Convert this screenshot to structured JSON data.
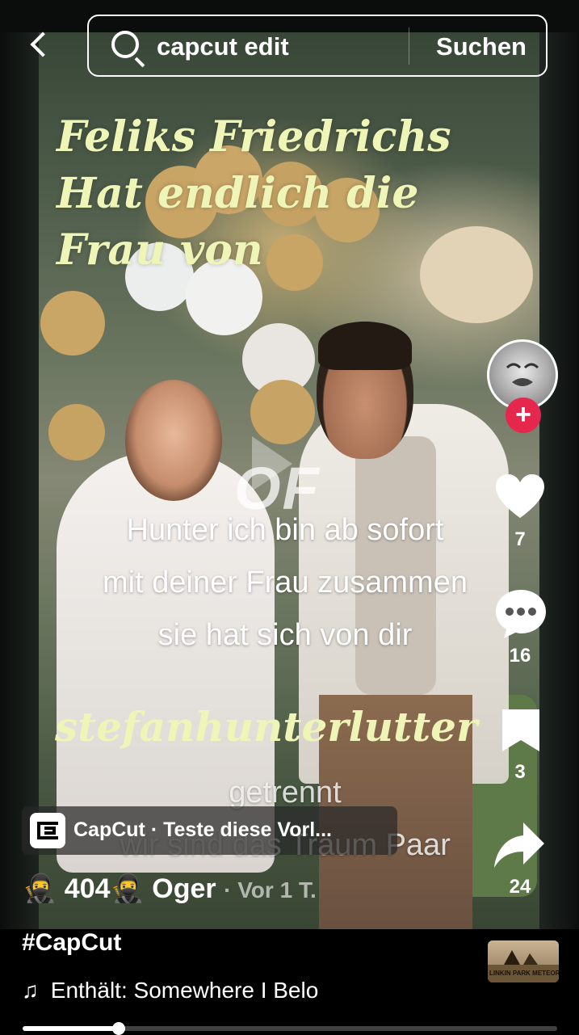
{
  "search": {
    "query": "capcut edit",
    "button_label": "Suchen"
  },
  "video": {
    "title_lines": [
      "Feliks Friedrichs",
      "Hat endlich die",
      "Frau von"
    ],
    "watermark": "OF",
    "caption_lines": [
      "Hunter ich bin ab sofort",
      "mit deiner Frau zusammen",
      "sie hat sich von dir"
    ],
    "handle_overlay": "stefanhunterlutter",
    "caption_lines_2": [
      "getrennt",
      "wir sind das Traum Paar"
    ]
  },
  "actions": {
    "likes": "7",
    "comments": "16",
    "saves": "3",
    "shares": "24"
  },
  "capcut": {
    "label": "CapCut · Teste diese Vorl..."
  },
  "post": {
    "author": "🥷 404🥷 Oger",
    "time": "· Vor 1 T.",
    "hashtag": "#CapCut",
    "music": "Enthält: Somewhere I Belo",
    "music_disc_label": "LINKIN PARK METEORA DEMO",
    "progress": 0.18
  },
  "colors": {
    "overlay_text": "#eef5b7",
    "follow_button": "#e5264d"
  }
}
